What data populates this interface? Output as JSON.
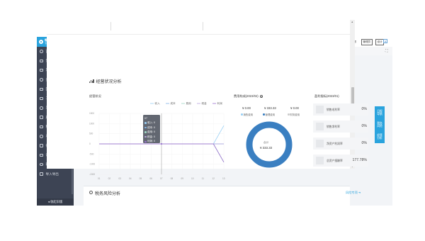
{
  "sidebar": {
    "logo_title": "畅捷通好会计",
    "logo_subtitle": "专业版",
    "items": [
      {
        "label": "首页",
        "icon": "home-icon"
      },
      {
        "label": "凭证",
        "icon": "voucher-icon"
      },
      {
        "label": "票据中心",
        "icon": "invoice-icon"
      },
      {
        "label": "资金管理",
        "icon": "fund-icon"
      },
      {
        "label": "固定资产",
        "icon": "asset-icon"
      },
      {
        "label": "工资",
        "icon": "salary-icon"
      },
      {
        "label": "发票管理",
        "icon": "receipt-icon"
      },
      {
        "label": "期初余额",
        "icon": "balance-icon"
      },
      {
        "label": "税务管理",
        "icon": "tax-icon"
      },
      {
        "label": "总账",
        "icon": "ledger-icon"
      },
      {
        "label": "行政管理",
        "icon": "admin-icon"
      },
      {
        "label": "设置",
        "icon": "settings-icon"
      },
      {
        "label": "新手引导",
        "icon": "guide-icon"
      },
      {
        "label": "导入导出",
        "icon": "import-icon"
      }
    ],
    "footer": "◂ 收起旧版"
  },
  "topbar": {
    "company": "测试",
    "switch_label": "切换到旧",
    "status": "已启用",
    "period_label": "账期",
    "period_value": "2023-02",
    "service_label": "人工咨询",
    "manage_label": "管理员",
    "settings_label": "设计",
    "close": "✕"
  },
  "tabs": {
    "home": "首页"
  },
  "section": {
    "title": "经营状况分析"
  },
  "chart_data": {
    "type": "line",
    "title": "经营状况",
    "categories": [
      "01",
      "02",
      "03",
      "04",
      "05",
      "06",
      "07",
      "08",
      "09",
      "10",
      "11",
      "12",
      "13"
    ],
    "y_ticks": [
      "1500",
      "1000",
      "500",
      "0",
      "-500",
      "-1000",
      "-1500"
    ],
    "ylim": [
      -1500,
      1500
    ],
    "series": [
      {
        "name": "收入",
        "color": "#9ad0f5",
        "values": [
          0,
          0,
          0,
          0,
          0,
          0,
          0,
          0,
          0,
          0,
          0,
          0,
          900
        ]
      },
      {
        "name": "成本",
        "color": "#7fb3e6",
        "values": [
          0,
          0,
          0,
          0,
          0,
          0,
          0,
          0,
          0,
          0,
          0,
          0,
          0
        ]
      },
      {
        "name": "费用",
        "color": "#9fd7c4",
        "values": [
          0,
          0,
          0,
          0,
          0,
          0,
          0,
          0,
          0,
          0,
          0,
          0,
          -900
        ]
      },
      {
        "name": "税金",
        "color": "#b9a4dd",
        "values": [
          0,
          0,
          0,
          0,
          0,
          0,
          0,
          0,
          0,
          0,
          0,
          0,
          0
        ]
      },
      {
        "name": "利润",
        "color": "#9b6fd0",
        "values": [
          0,
          0,
          0,
          0,
          0,
          0,
          0,
          0,
          0,
          0,
          0,
          0,
          -900
        ]
      }
    ],
    "tooltip": {
      "title": "07",
      "rows": [
        {
          "label": "收入: 0",
          "color": "#9ad0f5"
        },
        {
          "label": "成本: 0",
          "color": "#7fb3e6"
        },
        {
          "label": "费用: 0",
          "color": "#9fd7c4"
        },
        {
          "label": "税金: 0",
          "color": "#b9a4dd"
        },
        {
          "label": "利润: 0",
          "color": "#9b6fd0"
        }
      ]
    }
  },
  "expense": {
    "title": "费用构成(2023/02)",
    "values": [
      "¥ 0.00",
      "¥ 333.33",
      "¥ 0.00"
    ],
    "legends": [
      {
        "label": "销售费用",
        "color": "#9ad0f5"
      },
      {
        "label": "管理费用",
        "color": "#3a7fc1"
      },
      {
        "label": "财务费用",
        "color": "#cccccc"
      }
    ],
    "donut_label": "合计",
    "donut_value": "¥ 333.33",
    "donut_color": "#3a7fc1"
  },
  "profit": {
    "title": "盈利指标(2023/01)",
    "cards": [
      {
        "label": "销售毛利率",
        "value": "0%"
      },
      {
        "label": "销售净利率",
        "value": "0%"
      },
      {
        "label": "净资产利润率",
        "value": "0%"
      },
      {
        "label": "总资产报酬率",
        "value": "177.78%"
      }
    ]
  },
  "side_tabs": [
    "日报导航",
    "税务风险",
    "经营分析"
  ],
  "tax_section": {
    "title": "税务风险分析",
    "link": "风险专项 ➜"
  }
}
